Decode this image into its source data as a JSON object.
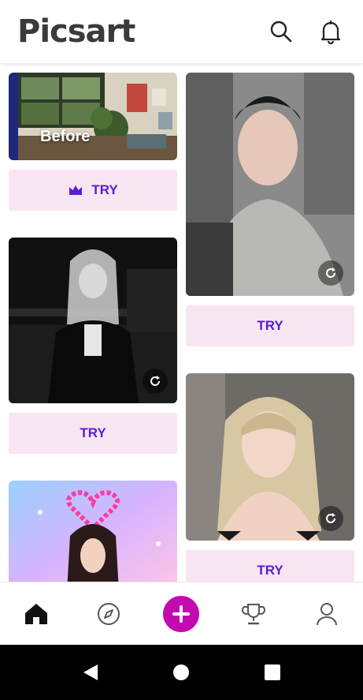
{
  "app": {
    "name": "Picsart"
  },
  "icons": {
    "search": "search-icon",
    "notifications": "bell-icon",
    "crown": "crown-icon",
    "redo": "redo-icon",
    "home": "home-icon",
    "explore": "compass-icon",
    "create": "plus-icon",
    "challenges": "trophy-icon",
    "profile": "person-icon"
  },
  "colors": {
    "accent": "#c30ab0",
    "try_bg": "#f7e6f2",
    "try_text": "#5c1bd4"
  },
  "feed": {
    "cards": [
      {
        "image": "room-before-photo",
        "overlay_text": "Before",
        "button": "TRY",
        "premium": true
      },
      {
        "image": "young-man-portrait",
        "button": "TRY"
      },
      {
        "image": "woman-dark-street-photo",
        "button": "TRY"
      },
      {
        "image": "blonde-braids-portrait",
        "button": "TRY"
      },
      {
        "image": "pixel-heart-sticker-photo",
        "button": ""
      }
    ]
  },
  "bottom_nav": [
    "home",
    "explore",
    "create",
    "challenges",
    "profile"
  ],
  "system_nav": [
    "back",
    "home",
    "recents"
  ]
}
